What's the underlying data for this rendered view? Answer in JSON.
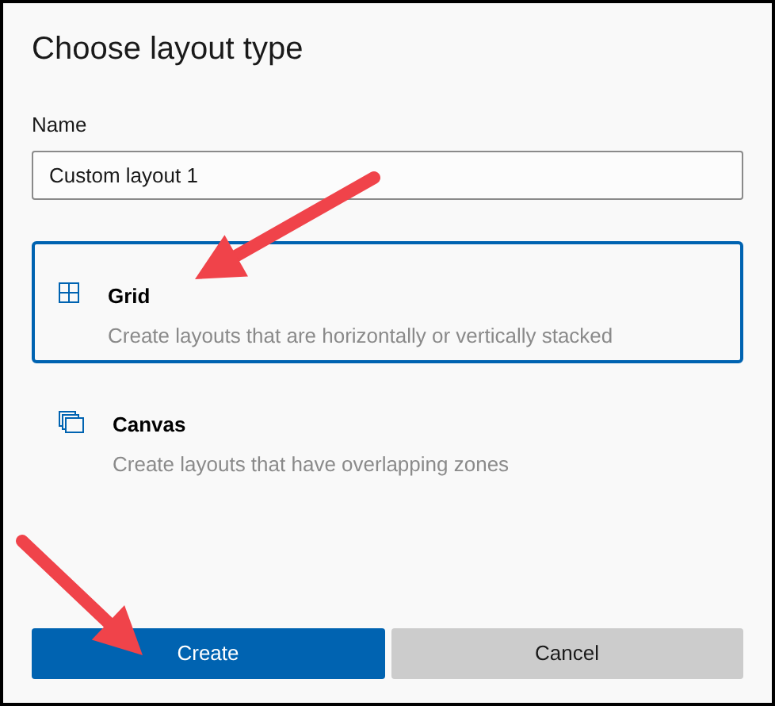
{
  "title": "Choose layout type",
  "name_field": {
    "label": "Name",
    "value": "Custom layout 1"
  },
  "options": [
    {
      "kind": "grid",
      "title": "Grid",
      "description": "Create layouts that are horizontally or vertically stacked",
      "selected": true
    },
    {
      "kind": "canvas",
      "title": "Canvas",
      "description": "Create layouts that have overlapping zones",
      "selected": false
    }
  ],
  "buttons": [
    {
      "label": "Create",
      "kind": "primary"
    },
    {
      "label": "Cancel",
      "kind": "secondary"
    }
  ]
}
